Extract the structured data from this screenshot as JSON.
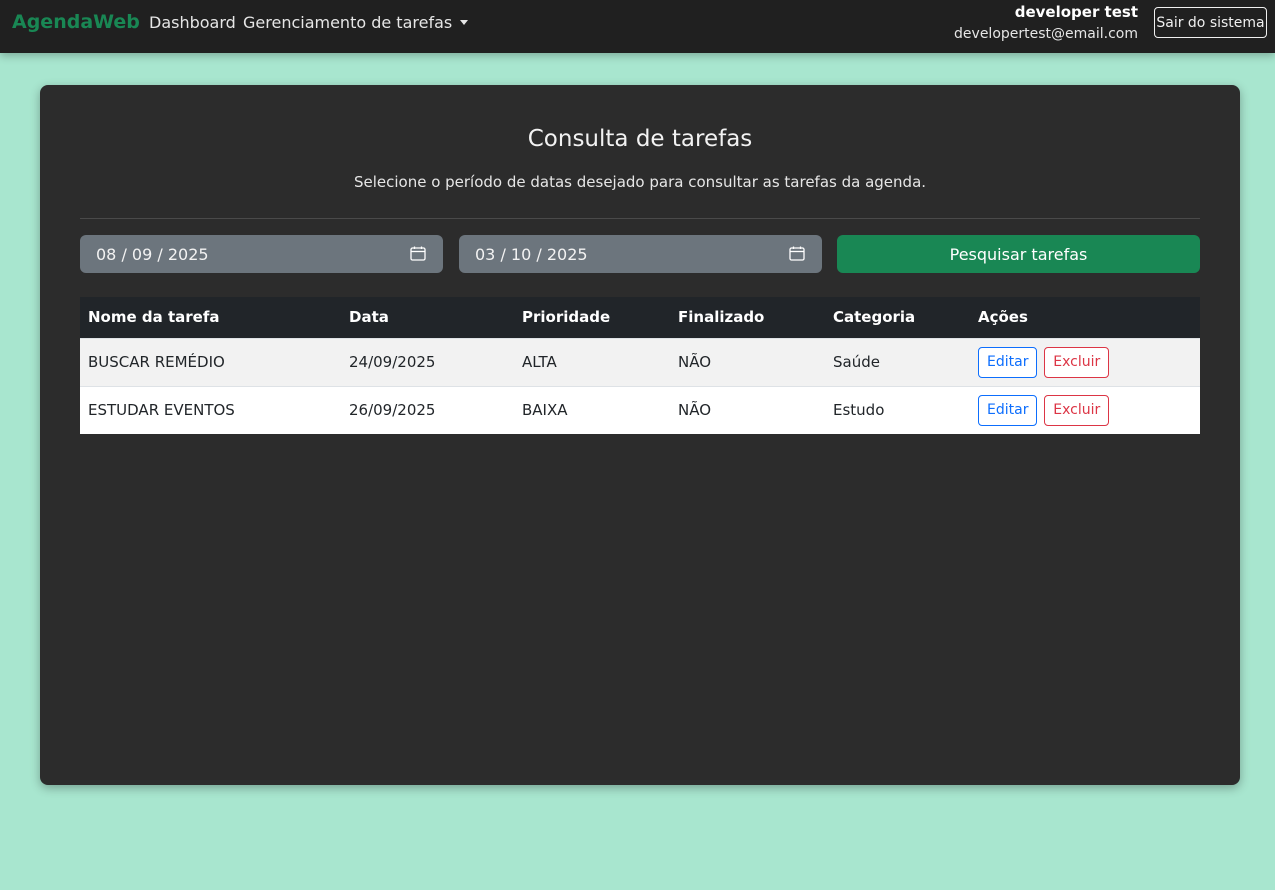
{
  "navbar": {
    "brand": "AgendaWeb",
    "links": {
      "dashboard": "Dashboard",
      "tasks_menu": "Gerenciamento de tarefas"
    },
    "user": {
      "name": "developer test",
      "email": "developertest@email.com"
    },
    "logout_label": "Sair do sistema"
  },
  "main": {
    "title": "Consulta de tarefas",
    "subtitle": "Selecione o período de datas desejado para consultar as tarefas da agenda.",
    "filters": {
      "start_date": "08 / 09 / 2025",
      "end_date": "03 / 10 / 2025",
      "search_label": "Pesquisar tarefas"
    },
    "table": {
      "headers": [
        "Nome da tarefa",
        "Data",
        "Prioridade",
        "Finalizado",
        "Categoria",
        "Ações"
      ],
      "rows": [
        {
          "name": "BUSCAR REMÉDIO",
          "date": "24/09/2025",
          "priority": "ALTA",
          "done": "NÃO",
          "category": "Saúde"
        },
        {
          "name": "ESTUDAR EVENTOS",
          "date": "26/09/2025",
          "priority": "BAIXA",
          "done": "NÃO",
          "category": "Estudo"
        }
      ],
      "actions": {
        "edit": "Editar",
        "delete": "Excluir"
      }
    }
  },
  "colors": {
    "page_bg": "#a8e6cf",
    "navbar_bg": "#202020",
    "brand": "#198754",
    "card_bg": "#2c2c2c",
    "primary_action": "#198754",
    "edit": "#0d6efd",
    "delete": "#dc3545"
  },
  "icons": [
    "calendar-icon",
    "chevron-down-icon"
  ]
}
